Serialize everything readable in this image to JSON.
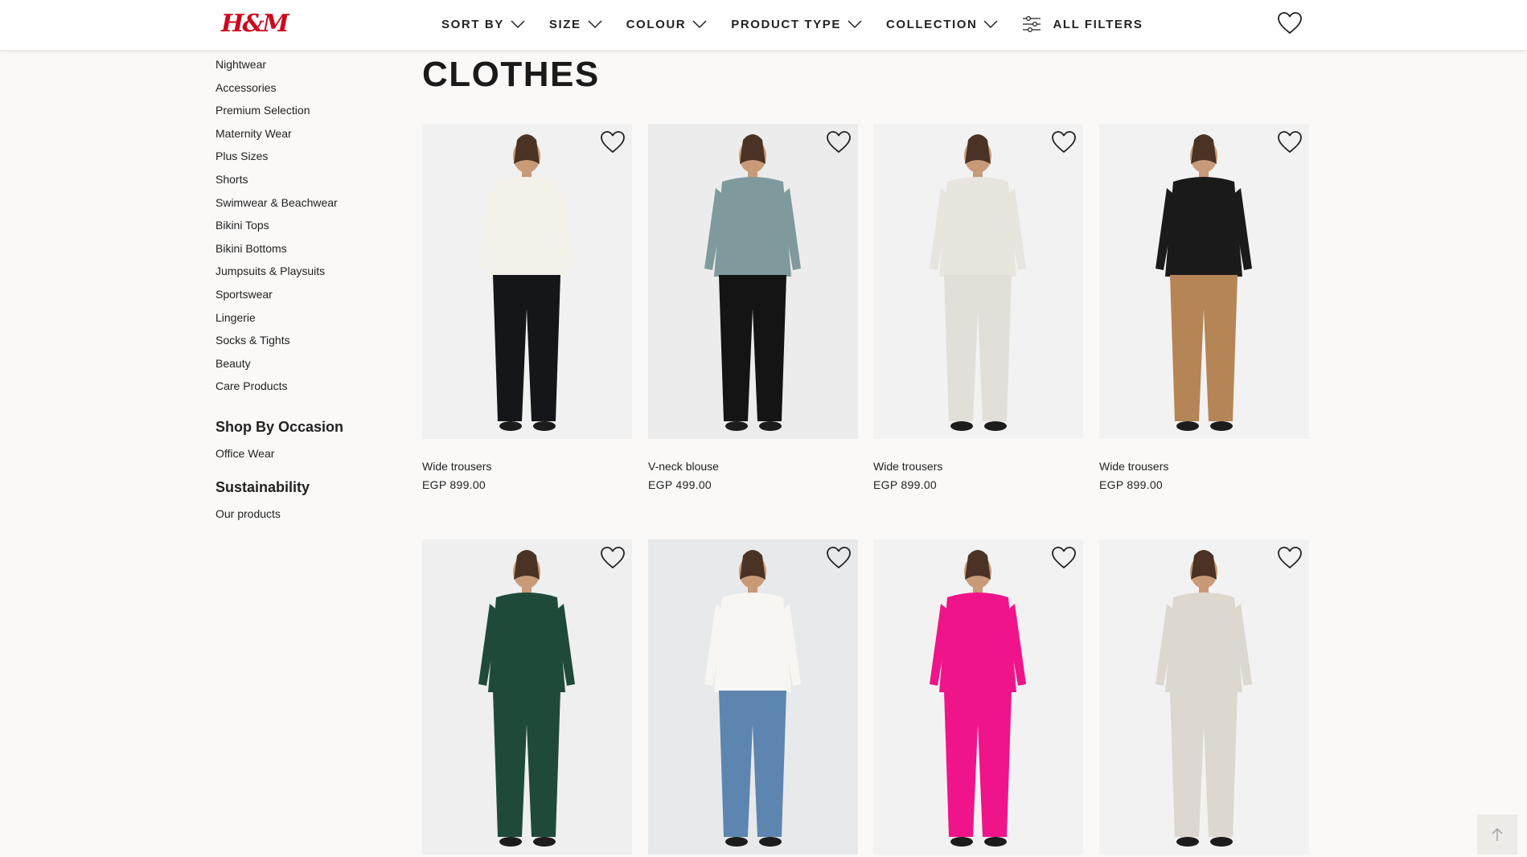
{
  "header": {
    "logo": "H&M",
    "filters": [
      {
        "label": "SORT BY"
      },
      {
        "label": "SIZE"
      },
      {
        "label": "COLOUR"
      },
      {
        "label": "PRODUCT TYPE"
      },
      {
        "label": "COLLECTION"
      }
    ],
    "all_filters": "ALL FILTERS"
  },
  "sidebar": {
    "categories": [
      "Nightwear",
      "Accessories",
      "Premium Selection",
      "Maternity Wear",
      "Plus Sizes",
      "Shorts",
      "Swimwear & Beachwear",
      "Bikini Tops",
      "Bikini Bottoms",
      "Jumpsuits & Playsuits",
      "Sportswear",
      "Lingerie",
      "Socks & Tights",
      "Beauty",
      "Care Products"
    ],
    "occasion_heading": "Shop By Occasion",
    "occasion_link": "Office Wear",
    "sustainability_heading": "Sustainability",
    "sustainability_link": "Our products"
  },
  "main": {
    "title": "CLOTHES",
    "products": [
      {
        "name": "Wide trousers",
        "price": "EGP  899.00",
        "top_color": "#f4f1ea",
        "bottom_color": "#15161a",
        "bg": "#f1f1f1"
      },
      {
        "name": "V-neck blouse",
        "price": "EGP  499.00",
        "top_color": "#7f9a9c",
        "bottom_color": "#141414",
        "bg": "#ececec"
      },
      {
        "name": "Wide trousers",
        "price": "EGP  899.00",
        "top_color": "#e8e5df",
        "bottom_color": "#e2dfd9",
        "bg": "#f2f2f2"
      },
      {
        "name": "Wide trousers",
        "price": "EGP  899.00",
        "top_color": "#1a1a1a",
        "bottom_color": "#b58556",
        "bg": "#f2f2f2"
      },
      {
        "name": "",
        "price": "",
        "top_color": "#1f4a3a",
        "bottom_color": "#1f4a3a",
        "bg": "#efefef"
      },
      {
        "name": "",
        "price": "",
        "top_color": "#f7f6f2",
        "bottom_color": "#5c86b0",
        "bg": "#e8e9ea"
      },
      {
        "name": "",
        "price": "",
        "top_color": "#f0148a",
        "bottom_color": "#f0148a",
        "bg": "#f2f2f2"
      },
      {
        "name": "",
        "price": "",
        "top_color": "#dcd8cf",
        "bottom_color": "#dcd8cf",
        "bg": "#f2f2f2"
      }
    ]
  },
  "colors": {
    "brand": "#cc071e",
    "background": "#faf9f8",
    "text": "#222222"
  }
}
